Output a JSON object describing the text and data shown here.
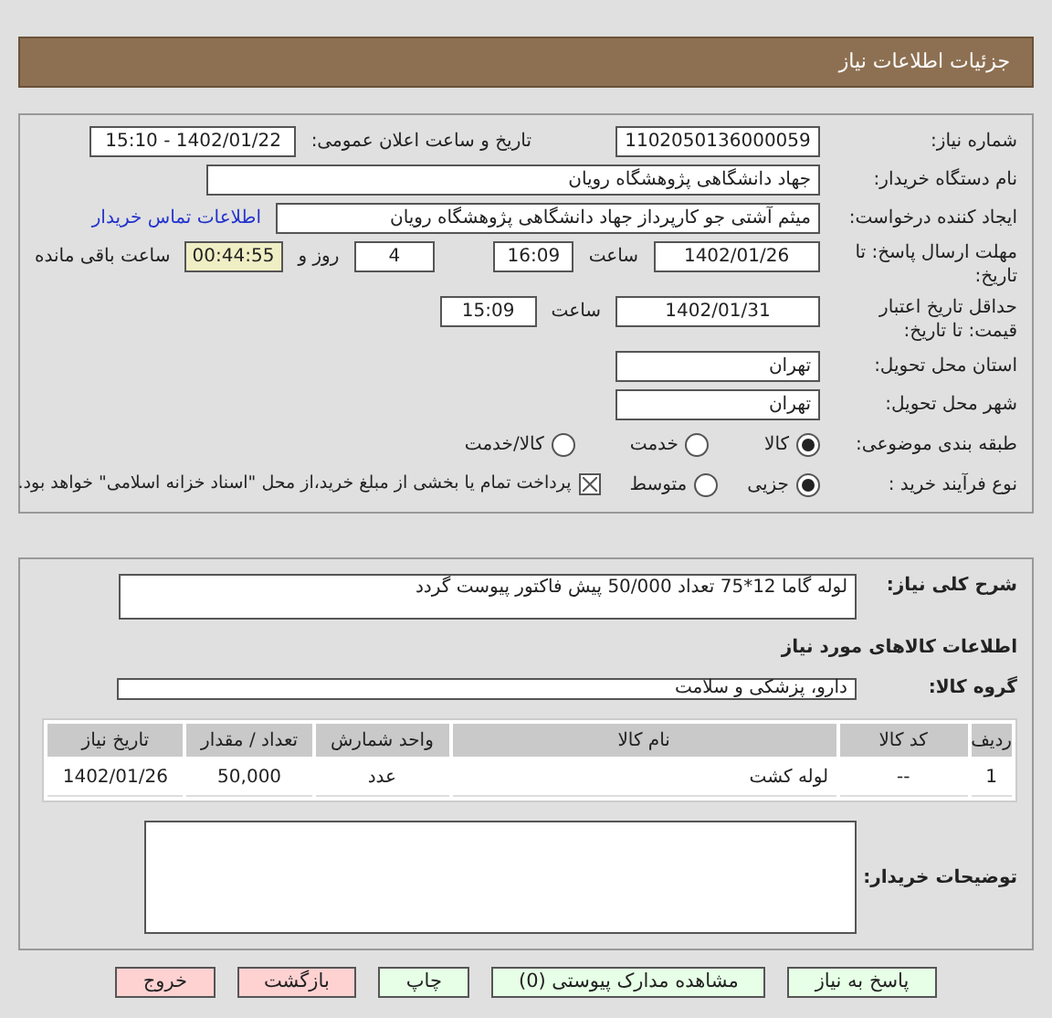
{
  "header": {
    "title": "جزئیات اطلاعات نیاز"
  },
  "need_number": {
    "label": "شماره نیاز:",
    "value": "1102050136000059"
  },
  "announce": {
    "label": "تاریخ و ساعت اعلان عمومی:",
    "value": "1402/01/22 - 15:10"
  },
  "buyer": {
    "label": "نام دستگاه خریدار:",
    "value": "جهاد دانشگاهی پژوهشگاه رویان"
  },
  "creator": {
    "label": "ایجاد کننده درخواست:",
    "value": "میثم  آشتی جو کارپرداز جهاد دانشگاهی پژوهشگاه رویان",
    "link": "اطلاعات تماس خریدار"
  },
  "deadline": {
    "label": "مهلت ارسال پاسخ: تا تاریخ:",
    "date": "1402/01/26",
    "time_label": "ساعت",
    "time": "16:09",
    "days": "4",
    "days_label": "روز و",
    "remaining": "00:44:55",
    "remaining_label": "ساعت باقی مانده"
  },
  "validity": {
    "label": "حداقل تاریخ اعتبار قیمت: تا تاریخ:",
    "date": "1402/01/31",
    "time_label": "ساعت",
    "time": "15:09"
  },
  "province": {
    "label": "استان محل تحویل:",
    "value": "تهران"
  },
  "city": {
    "label": "شهر محل تحویل:",
    "value": "تهران"
  },
  "category": {
    "label": "طبقه بندی موضوعی:",
    "options": [
      {
        "label": "کالا",
        "selected": true
      },
      {
        "label": "خدمت",
        "selected": false
      },
      {
        "label": "کالا/خدمت",
        "selected": false
      }
    ]
  },
  "process": {
    "label": "نوع فرآیند خرید :",
    "options": [
      {
        "label": "جزیی",
        "selected": true
      },
      {
        "label": "متوسط",
        "selected": false
      }
    ],
    "note": {
      "label": "پرداخت تمام یا بخشی از مبلغ خرید،از محل \"اسناد خزانه اسلامی\" خواهد بود.",
      "checked": true
    }
  },
  "description": {
    "label": "شرح کلی نیاز:",
    "value": "لوله گاما 12*75 تعداد 50/000 پیش فاکتور پیوست گردد"
  },
  "goods_title": "اطلاعات کالاهای مورد نیاز",
  "group": {
    "label": "گروه کالا:",
    "value": "دارو، پزشکی و سلامت"
  },
  "table": {
    "columns": [
      "ردیف",
      "کد کالا",
      "نام کالا",
      "واحد شمارش",
      "تعداد / مقدار",
      "تاریخ نیاز"
    ],
    "rows": [
      [
        "1",
        "--",
        "لوله کشت",
        "عدد",
        "50,000",
        "1402/01/26"
      ]
    ]
  },
  "buyer_notes": {
    "label": "توضیحات خریدار:"
  },
  "buttons": [
    {
      "label": "پاسخ به نیاز",
      "kind": "green"
    },
    {
      "label": "مشاهده مدارک پیوستی (0)",
      "kind": "green"
    },
    {
      "label": "چاپ",
      "kind": "green"
    },
    {
      "label": "بازگشت",
      "kind": "red"
    },
    {
      "label": "خروج",
      "kind": "red"
    }
  ]
}
